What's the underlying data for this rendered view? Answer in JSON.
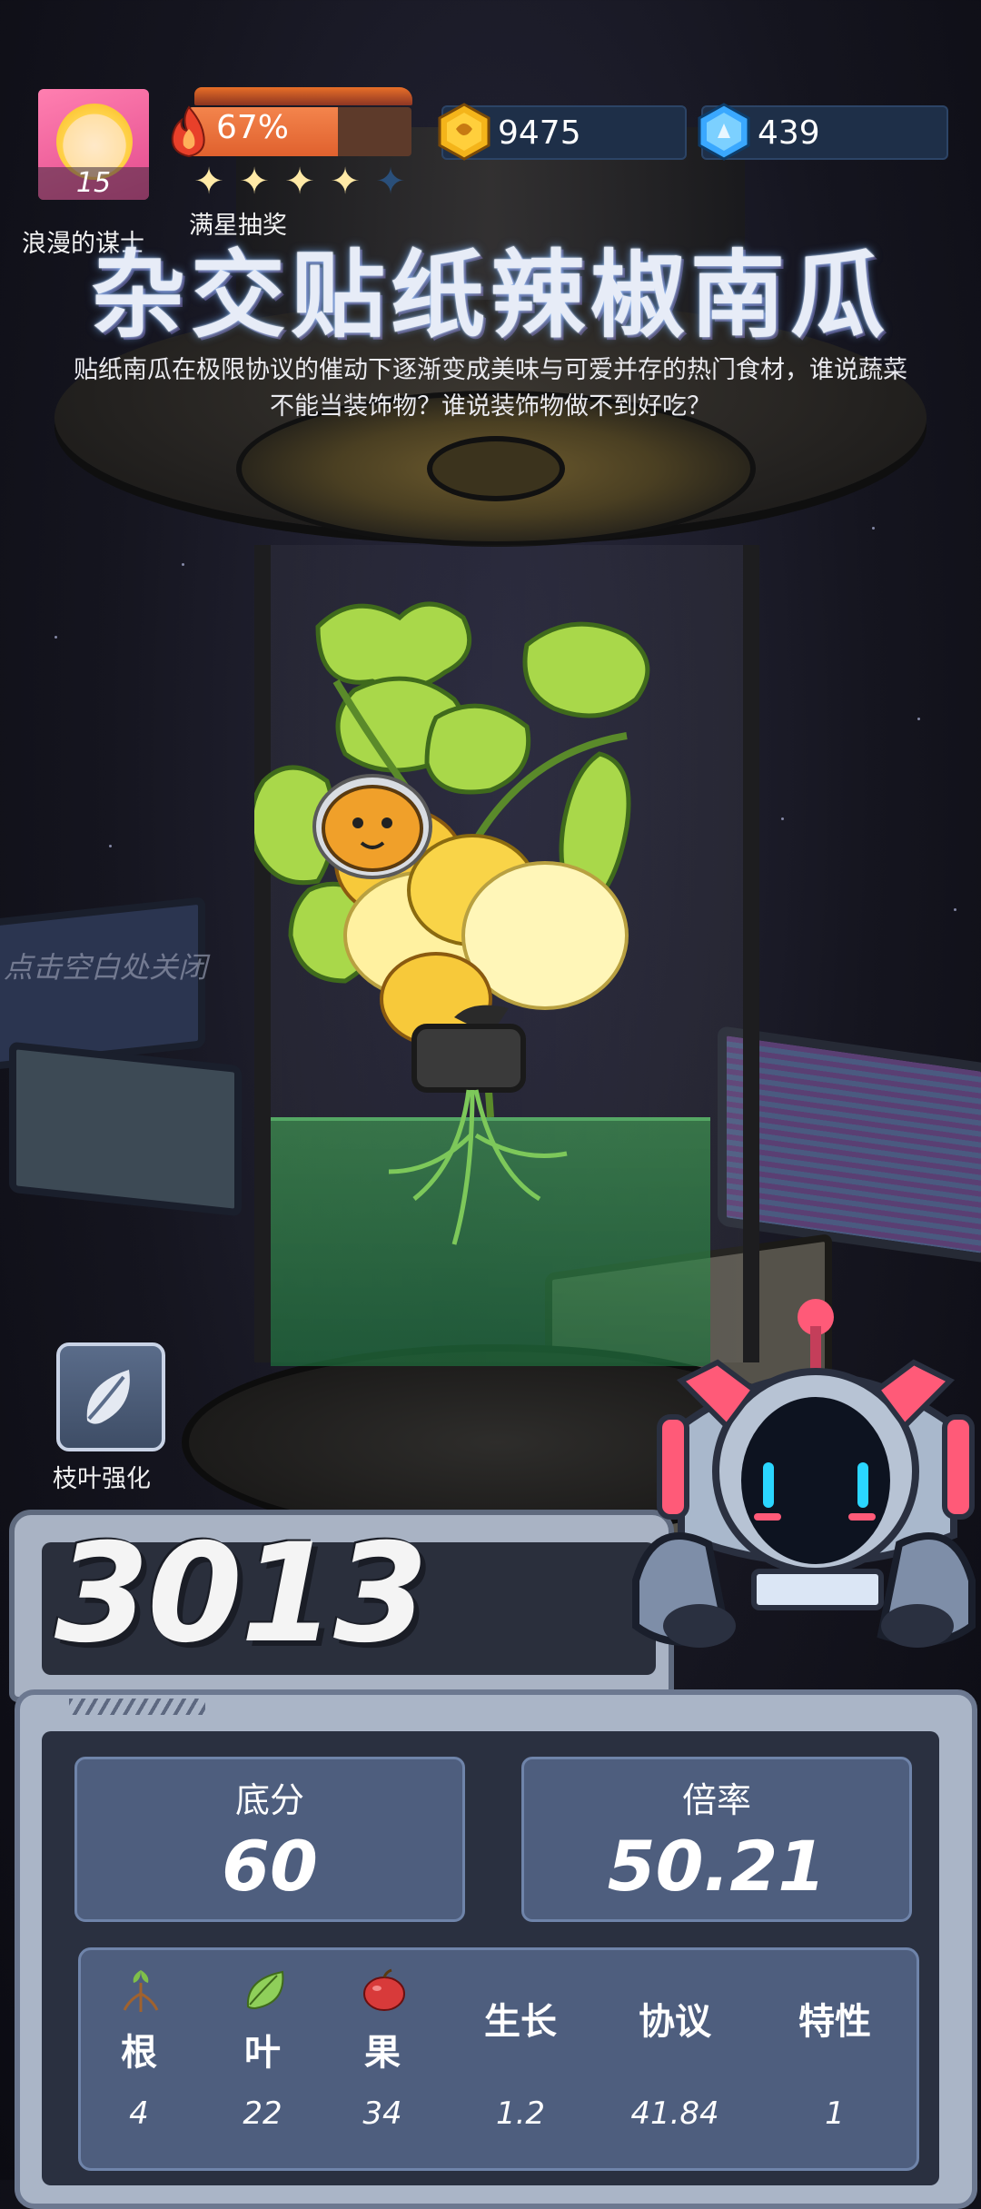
{
  "hud": {
    "avatar_level": "15",
    "player_name": "浪漫的谋士",
    "energy_percent_text": "67%",
    "energy_fraction": 0.67,
    "stars_filled": 4,
    "stars_total": 5,
    "star_draw_label": "满星抽奖",
    "gold_amount": "9475",
    "gem_amount": "439"
  },
  "title": "杂交贴纸辣椒南瓜",
  "description": "贴纸南瓜在极限协议的催动下逐渐变成美味与可爱并存的热门食材，谁说蔬菜不能当装饰物？谁说装饰物做不到好吃？",
  "close_hint": "点击空白处关闭",
  "leaf_button_label": "枝叶强化",
  "score": "3013",
  "stats": {
    "base_label": "底分",
    "base_value": "60",
    "multiplier_label": "倍率",
    "multiplier_value": "50.21"
  },
  "attributes": [
    {
      "label": "根",
      "value": "4",
      "icon": "root-icon"
    },
    {
      "label": "叶",
      "value": "22",
      "icon": "leaf-icon"
    },
    {
      "label": "果",
      "value": "34",
      "icon": "fruit-icon"
    },
    {
      "label": "生长",
      "value": "1.2",
      "icon": ""
    },
    {
      "label": "协议",
      "value": "41.84",
      "icon": ""
    },
    {
      "label": "特性",
      "value": "1",
      "icon": ""
    }
  ],
  "colors": {
    "energy": "#e0612e",
    "gold": "#f4b41a",
    "gem": "#3aa8ff",
    "panel": "#4e5e7e"
  }
}
